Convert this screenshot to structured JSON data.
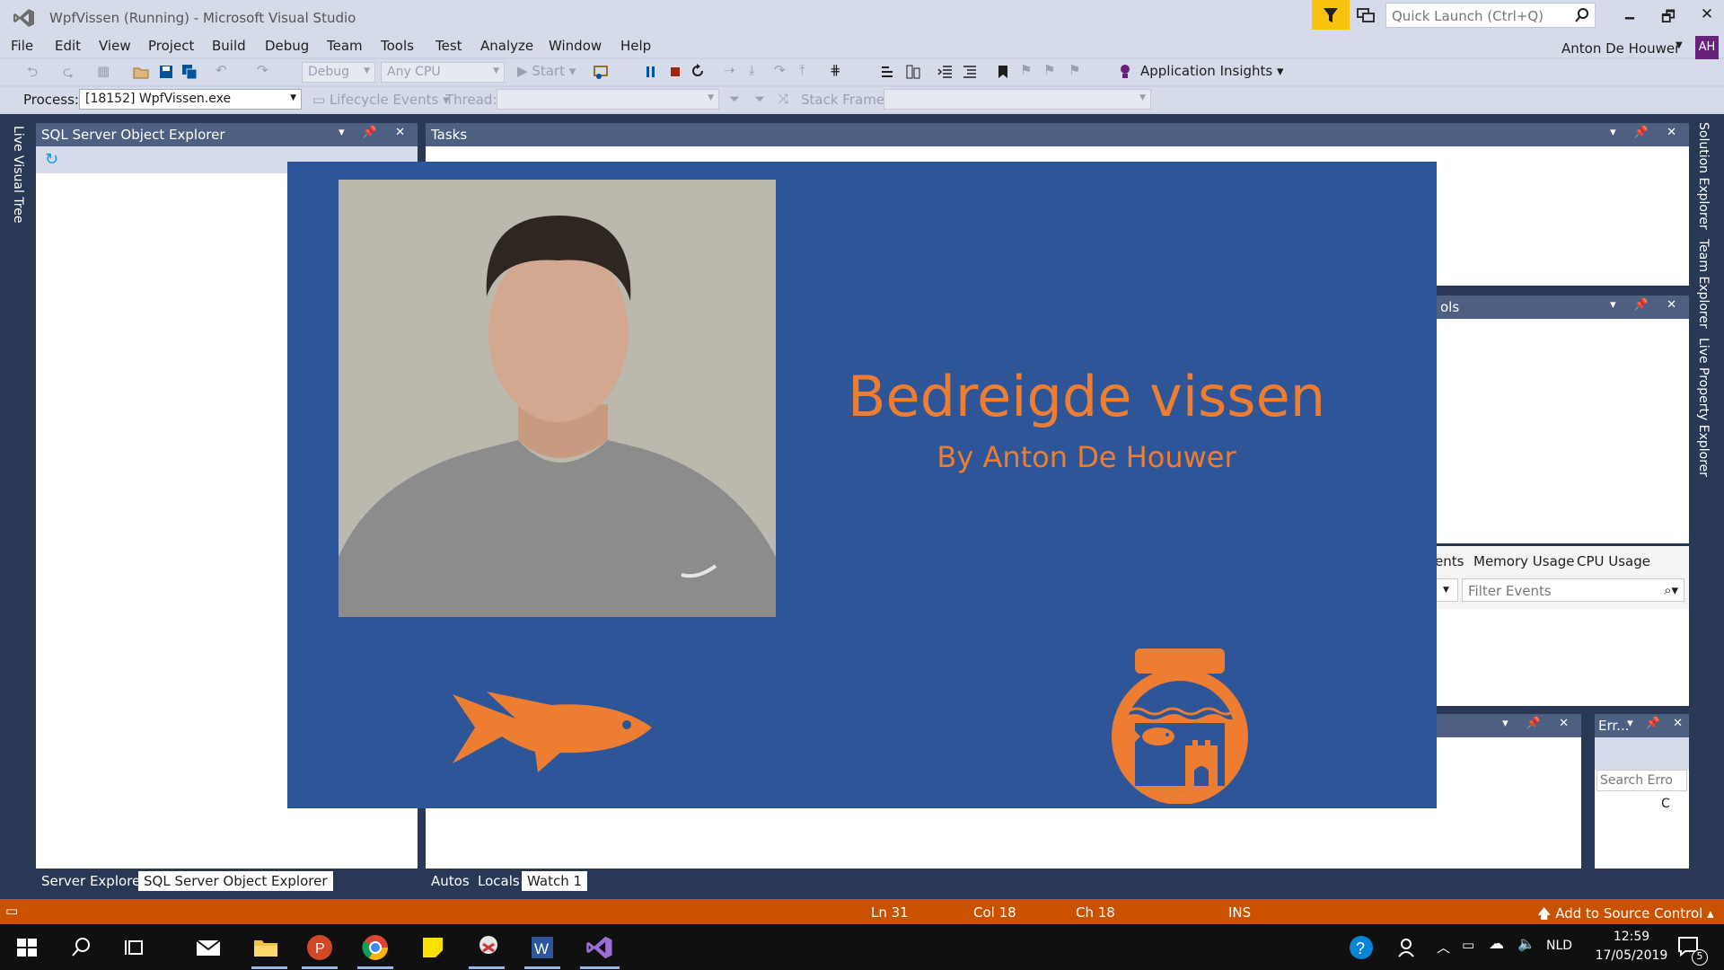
{
  "window": {
    "title": "WpfVissen (Running) - Microsoft Visual Studio",
    "quick_launch_placeholder": "Quick Launch (Ctrl+Q)",
    "controls": {
      "minimize": "🗕",
      "restore": "🗗",
      "close": "✕"
    }
  },
  "menu": {
    "items": [
      "File",
      "Edit",
      "View",
      "Project",
      "Build",
      "Debug",
      "Team",
      "Tools",
      "Test",
      "Analyze",
      "Window",
      "Help"
    ],
    "user_name": "Anton De Houwer",
    "user_initials": "AH"
  },
  "toolbar": {
    "config": "Debug",
    "platform": "Any CPU",
    "start_label": "Start",
    "app_insights": "Application Insights",
    "process_label": "Process:",
    "process_value": "[18152] WpfVissen.exe",
    "lifecycle_label": "Lifecycle Events",
    "thread_label": "Thread:",
    "stack_label": "Stack Frame:"
  },
  "side_tabs": {
    "left": "Live Visual Tree",
    "right": [
      "Solution Explorer",
      "Team Explorer",
      "Live Property Explorer"
    ]
  },
  "panels": {
    "sql_explorer_title": "SQL Server Object Explorer",
    "tasks_title": "Tasks",
    "diag_tools_partial": "ols",
    "events_tab_partial": "ents",
    "memory_tab": "Memory Usage",
    "cpu_tab": "CPU Usage",
    "filter_events_placeholder": "Filter Events",
    "error_title_partial": "Err...",
    "search_errors_placeholder": "Search Erro",
    "error_col_partial": "C"
  },
  "bottom_tabs": {
    "left": [
      "Server Explorer",
      "SQL Server Object Explorer"
    ],
    "middle": [
      "Autos",
      "Locals",
      "Watch 1"
    ]
  },
  "app": {
    "title": "Bedreigde vissen",
    "subtitle": "By Anton De Houwer",
    "accent": "#ed7d31",
    "background": "#2e5597"
  },
  "status": {
    "ln": "Ln 31",
    "col": "Col 18",
    "ch": "Ch 18",
    "ins": "INS",
    "source_control": "Add to Source Control"
  },
  "taskbar": {
    "language": "NLD",
    "time": "12:59",
    "date": "17/05/2019",
    "notifications": "5"
  }
}
